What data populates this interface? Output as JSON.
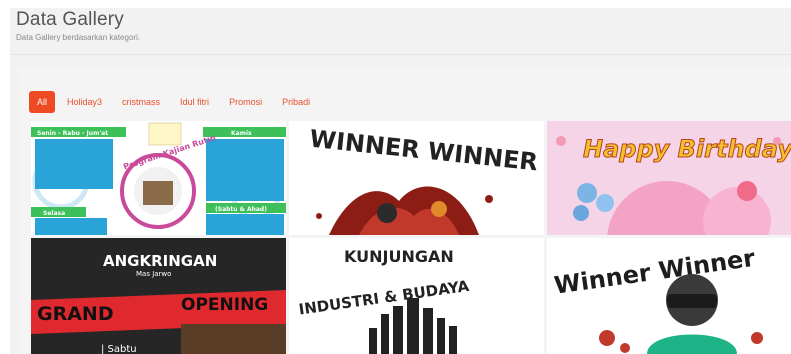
{
  "header": {
    "title": "Data Gallery",
    "subtitle": "Data Gallery berdasarkan kategori."
  },
  "filters": [
    {
      "label": "All",
      "active": true
    },
    {
      "label": "Holiday3",
      "active": false
    },
    {
      "label": "cristmass",
      "active": false
    },
    {
      "label": "Idul fitri",
      "active": false
    },
    {
      "label": "Promosi",
      "active": false
    },
    {
      "label": "Pribadi",
      "active": false
    }
  ],
  "gallery": {
    "tile1": {
      "days_a": "Senin - Rabu - Jum'at",
      "days_b": "Kamis",
      "days_c": "Selasa",
      "days_d": "(Sabtu & Ahad)",
      "badge": "Program Kajian Rutin"
    },
    "tile2": {
      "text": "WINNER WINNER"
    },
    "tile3": {
      "text": "Happy Birthday"
    },
    "tile4": {
      "line1": "ANGKRINGAN",
      "line2": "Mas Jarwo",
      "line3": "GRAND",
      "line4": "OPENING",
      "line5": "| Sabtu"
    },
    "tile5": {
      "line1": "KUNJUNGAN",
      "line2": "INDUSTRI & BUDAYA"
    },
    "tile6": {
      "text": "Winner Winner"
    }
  },
  "colors": {
    "accent": "#ee4a23",
    "tile1_green": "#3dbf5a",
    "tile1_blue": "#2aa4d8",
    "tile3_pink": "#f6d4e8"
  }
}
